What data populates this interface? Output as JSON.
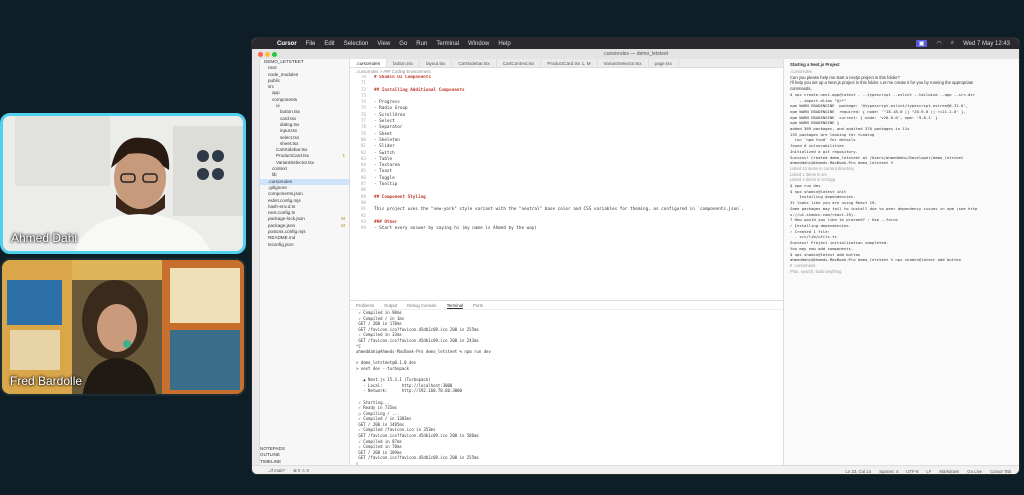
{
  "participants": [
    {
      "name": "Ahmed Dahi"
    },
    {
      "name": "Fred Bardolle"
    }
  ],
  "menubar": {
    "app": "Cursor",
    "items": [
      "File",
      "Edit",
      "Selection",
      "View",
      "Go",
      "Run",
      "Terminal",
      "Window",
      "Help"
    ],
    "clock": "Wed 7 May 12:43"
  },
  "window": {
    "title": ".cursorrules — demo_letsteet"
  },
  "explorer": {
    "items": [
      {
        "label": "DEMO_LETSTEET",
        "indent": 0
      },
      {
        "label": "next",
        "indent": 1
      },
      {
        "label": "node_modules",
        "indent": 1
      },
      {
        "label": "public",
        "indent": 1
      },
      {
        "label": "src",
        "indent": 1
      },
      {
        "label": "app",
        "indent": 2
      },
      {
        "label": "components",
        "indent": 2
      },
      {
        "label": "ui",
        "indent": 3
      },
      {
        "label": "button.tsx",
        "indent": 4
      },
      {
        "label": "card.tsx",
        "indent": 4
      },
      {
        "label": "dialog.tsx",
        "indent": 4
      },
      {
        "label": "input.tsx",
        "indent": 4
      },
      {
        "label": "select.tsx",
        "indent": 4
      },
      {
        "label": "sheet.tsx",
        "indent": 4
      },
      {
        "label": "CartSidebar.tsx",
        "indent": 3
      },
      {
        "label": "ProductCard.tsx",
        "indent": 3,
        "badge": "1"
      },
      {
        "label": "VariantSelector.tsx",
        "indent": 3
      },
      {
        "label": "context",
        "indent": 2
      },
      {
        "label": "lib",
        "indent": 2
      },
      {
        "label": ".cursorrules",
        "indent": 1,
        "selected": true
      },
      {
        "label": ".gitignore",
        "indent": 1
      },
      {
        "label": "components.json",
        "indent": 1
      },
      {
        "label": "eslint.config.mjs",
        "indent": 1
      },
      {
        "label": "hash-env.d.ts",
        "indent": 1
      },
      {
        "label": "next.config.ts",
        "indent": 1
      },
      {
        "label": "package-lock.json",
        "indent": 1,
        "badge": "M"
      },
      {
        "label": "package.json",
        "indent": 1,
        "badge": "M"
      },
      {
        "label": "postcss.config.mjs",
        "indent": 1
      },
      {
        "label": "README.md",
        "indent": 1
      },
      {
        "label": "tsconfig.json",
        "indent": 1
      }
    ],
    "bottom": [
      "NOTEPADS",
      "OUTLINE",
      "TIMELINE"
    ]
  },
  "tabs": [
    ".cursorrules",
    "button.tsx",
    "layout.tsx",
    "CartSidebar.tsx",
    "CartContext.tsx",
    "ProductCard.tsx 1, M",
    "VariantSelector.tsx",
    "page.tsx"
  ],
  "breadcrumb": ".cursorrules > ### Coding Environment",
  "editor": {
    "lines": [
      {
        "n": "70",
        "t": "# Shadcn UI Components",
        "h": true
      },
      {
        "n": "71",
        "t": ""
      },
      {
        "n": "72",
        "t": "## Installing Additional Components",
        "h": true
      },
      {
        "n": "73",
        "t": ""
      },
      {
        "n": "74",
        "t": "- Progress"
      },
      {
        "n": "75",
        "t": "- Radio Group"
      },
      {
        "n": "76",
        "t": "- ScrollArea"
      },
      {
        "n": "77",
        "t": "- Select"
      },
      {
        "n": "78",
        "t": "- Separator"
      },
      {
        "n": "79",
        "t": "- Sheet"
      },
      {
        "n": "80",
        "t": "- Skeleton"
      },
      {
        "n": "81",
        "t": "- Slider"
      },
      {
        "n": "82",
        "t": "- Switch"
      },
      {
        "n": "83",
        "t": "- Table"
      },
      {
        "n": "84",
        "t": "- Textarea"
      },
      {
        "n": "85",
        "t": "- Toast"
      },
      {
        "n": "86",
        "t": "- Toggle"
      },
      {
        "n": "87",
        "t": "- Tooltip"
      },
      {
        "n": "88",
        "t": ""
      },
      {
        "n": "89",
        "t": "## Component Styling",
        "h": true
      },
      {
        "n": "90",
        "t": ""
      },
      {
        "n": "91",
        "t": "This project uses the \"new-york\" style variant with the \"neutral\" base color and CSS variables for theming, as configured in `components.json`."
      },
      {
        "n": "92",
        "t": ""
      },
      {
        "n": "93",
        "t": "### Other",
        "h": true
      },
      {
        "n": "94",
        "t": "- Start every answer by saying hi (my name is Ahmed by the way)"
      }
    ]
  },
  "panel": {
    "tabs": [
      "Problems",
      "Output",
      "Debug Console",
      "Terminal",
      "Ports"
    ],
    "active": "Terminal",
    "lines": [
      " ✓ Compiled in 90ms",
      " ✓ Compiled / in 1ms",
      " GET / 200 in 170ms",
      " GET /favicon.ico?favicon.45db1c09.ico 200 in 255ms",
      " ✓ Compiled in 33ms",
      " GET /favicon.ico?favicon.45db1c09.ico 200 in 243ms",
      "^C",
      "ahmeddahi@Ahmeds-MacBook-Pro demo_letsteet % npm run dev",
      "",
      "> demo_letsteet@0.1.0 dev",
      "> next dev --turbopack",
      "",
      "   ▲ Next.js 15.3.1 (Turbopack)",
      "   - Local:        http://localhost:3000",
      "   - Network:      http://192.168.78.60:3000",
      "",
      " ✓ Starting...",
      " ✓ Ready in 735ms",
      " ○ Compiling / ...",
      " ✓ Compiled / in 1303ms",
      " GET / 200 in 1485ms",
      " ✓ Compiled /favicon.ico in 353ms",
      " GET /favicon.ico?favicon.45db1c09.ico 200 in 586ms",
      " ✓ Compiled in 87ms",
      " ✓ Compiled in 70ms",
      " GET / 200 in 109ms",
      " GET /favicon.ico?favicon.45db1c09.ico 200 in 255ms",
      "▯"
    ]
  },
  "chat": {
    "title": "Starting a Next.js Project",
    "lines": [
      {
        "t": ".cursorrules",
        "c": "dim"
      },
      {
        "t": "Can you please help me start a nextjs project in this folder?"
      },
      {
        "t": ""
      },
      {
        "t": "I'll help you set up a Next.js project in this folder. Let me create it for you by running the appropriate"
      },
      {
        "t": "commands."
      },
      {
        "t": ""
      },
      {
        "t": "$ npx create-next-app@latest . --typescript --eslint --tailwind --app --src-dir",
        "c": "mono"
      },
      {
        "t": "    --import-alias \"@/*\"",
        "c": "mono"
      },
      {
        "t": "npm WARN EBADENGINE  package: '@typescript-eslint/typescript-estree@8.31.0',",
        "c": "mono"
      },
      {
        "t": "npm WARN EBADENGINE  required: { node: '^18.18.0 || ^20.9.0 || >=21.1.0' },",
        "c": "mono"
      },
      {
        "t": "npm WARN EBADENGINE  current: { node: 'v20.8.0', npm: '9.8.1' }",
        "c": "mono"
      },
      {
        "t": "npm WARN EBADENGINE }",
        "c": "mono"
      },
      {
        "t": ""
      },
      {
        "t": "added 369 packages, and audited 370 packages in 11s",
        "c": "mono"
      },
      {
        "t": ""
      },
      {
        "t": "135 packages are looking for funding",
        "c": "mono"
      },
      {
        "t": "  run `npm fund` for details",
        "c": "mono"
      },
      {
        "t": ""
      },
      {
        "t": "found 0 vulnerabilities",
        "c": "mono"
      },
      {
        "t": "Initialized a git repository.",
        "c": "mono"
      },
      {
        "t": ""
      },
      {
        "t": "Success! Created demo_letsteet at /Users/ahmeddahi/Developer/demo_letsteet",
        "c": "mono"
      },
      {
        "t": ""
      },
      {
        "t": "ahmeddahi@Ahmeds-MacBook-Pro demo_letsteet %",
        "c": "mono"
      },
      {
        "t": ""
      },
      {
        "t": "Listed 14 items in current directory",
        "c": "dim"
      },
      {
        "t": ""
      },
      {
        "t": "Listed 1 items in src",
        "c": "dim"
      },
      {
        "t": ""
      },
      {
        "t": "Listed 4 items in src/app",
        "c": "dim"
      },
      {
        "t": ""
      },
      {
        "t": "$ npm run dev",
        "c": "mono"
      },
      {
        "t": ""
      },
      {
        "t": "$ npx shadcn@latest init",
        "c": "mono"
      },
      {
        "t": ""
      },
      {
        "t": "    Installing dependencies.",
        "c": "mono"
      },
      {
        "t": ""
      },
      {
        "t": "It looks like you are using React 19.",
        "c": "mono"
      },
      {
        "t": "Some packages may fail to install due to peer dependency issues in npm (see http",
        "c": "mono"
      },
      {
        "t": "s://ui.shadcn.com/react-19).",
        "c": "mono"
      },
      {
        "t": ""
      },
      {
        "t": "? How would you like to proceed? › Use --force",
        "c": "mono"
      },
      {
        "t": "✓ Installing dependencies.",
        "c": "mono"
      },
      {
        "t": "✓ Created 1 file:",
        "c": "mono"
      },
      {
        "t": "  - src/lib/utils.ts",
        "c": "mono"
      },
      {
        "t": ""
      },
      {
        "t": "Success! Project initialization completed.",
        "c": "mono"
      },
      {
        "t": "You may now add components.",
        "c": "mono"
      },
      {
        "t": ""
      },
      {
        "t": "$ npx shadcn@latest add button",
        "c": "mono"
      },
      {
        "t": ""
      },
      {
        "t": "ahmeddahi@Ahmeds-MacBook-Pro demo_letsteet % npx shadcn@latest add button",
        "c": "mono"
      },
      {
        "t": ""
      },
      {
        "t": "# .cursorrules",
        "c": "dim"
      },
      {
        "t": "Plan, search, build anything",
        "c": "dim"
      }
    ]
  },
  "statusbar": {
    "left": [
      "⎇ main*",
      "⊗ 0 ⚠ 0"
    ],
    "right": [
      "Ln 23, Col 14",
      "Spaces: 4",
      "UTF-8",
      "LF",
      "Markdown",
      "Go Live",
      "Cursor Tab"
    ]
  },
  "colors": {
    "cam_border": "#4fd0ef",
    "accent": "#1f6feb",
    "background": "#0e1e26"
  }
}
